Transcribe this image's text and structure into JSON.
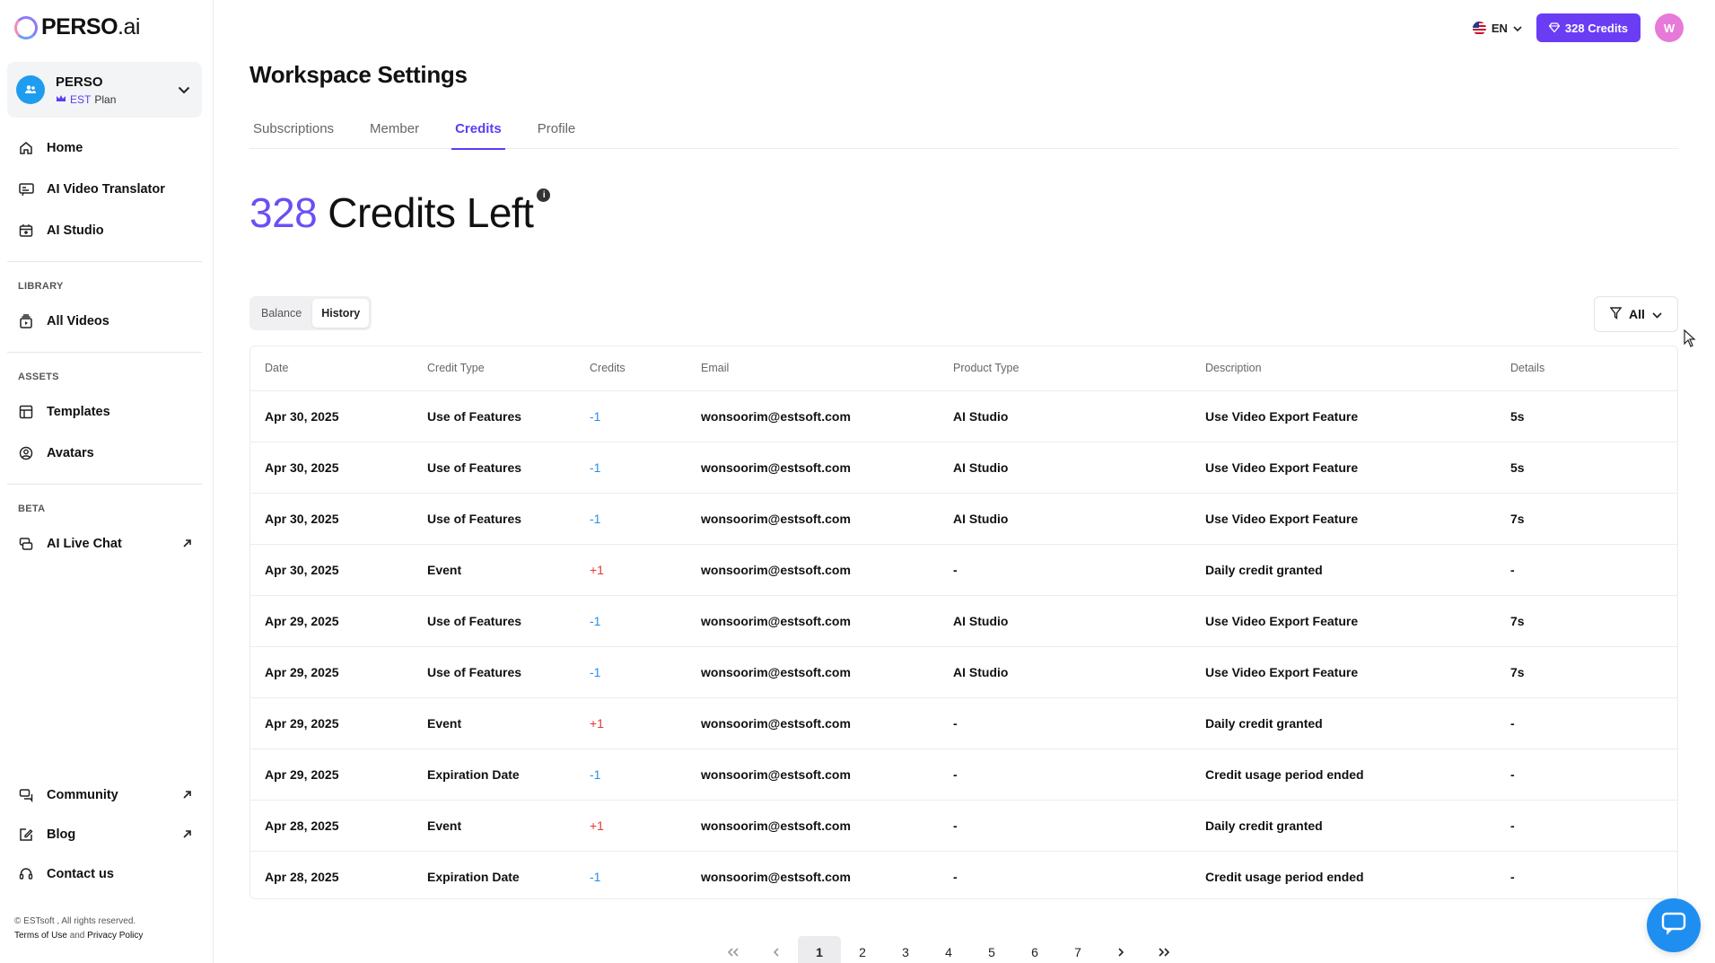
{
  "brand": {
    "logo_main": "PERSO",
    "logo_suffix": ".ai"
  },
  "workspace": {
    "name": "PERSO",
    "plan_badge": "EST",
    "plan_suffix": "Plan"
  },
  "nav": {
    "main": [
      {
        "label": "Home",
        "icon": "home-icon"
      },
      {
        "label": "AI Video Translator",
        "icon": "translate-icon"
      },
      {
        "label": "AI Studio",
        "icon": "studio-icon"
      }
    ],
    "library_label": "LIBRARY",
    "library": [
      {
        "label": "All Videos",
        "icon": "videos-icon"
      }
    ],
    "assets_label": "ASSETS",
    "assets": [
      {
        "label": "Templates",
        "icon": "templates-icon"
      },
      {
        "label": "Avatars",
        "icon": "avatar-icon"
      }
    ],
    "beta_label": "BETA",
    "beta": [
      {
        "label": "AI Live Chat",
        "icon": "live-chat-icon"
      }
    ],
    "bottom": [
      {
        "label": "Community",
        "icon": "community-icon"
      },
      {
        "label": "Blog",
        "icon": "blog-icon"
      },
      {
        "label": "Contact us",
        "icon": "headset-icon"
      }
    ]
  },
  "footer": {
    "copyright": "© ESTsoft , All rights reserved.",
    "terms": "Terms of Use",
    "and": "and",
    "privacy": "Privacy Policy"
  },
  "topbar": {
    "language": "EN",
    "credits_button": "328 Credits",
    "user_initial": "W"
  },
  "page": {
    "title": "Workspace Settings",
    "tabs": [
      "Subscriptions",
      "Member",
      "Credits",
      "Profile"
    ],
    "active_tab": "Credits",
    "credits_number": "328",
    "credits_text": "Credits Left",
    "segments": [
      "Balance",
      "History"
    ],
    "active_segment": "History",
    "filter_label": "All"
  },
  "table": {
    "headers": [
      "Date",
      "Credit Type",
      "Credits",
      "Email",
      "Product Type",
      "Description",
      "Details"
    ],
    "rows": [
      {
        "date": "Apr 30, 2025",
        "type": "Use of Features",
        "credits": "-1",
        "email": "wonsoorim@estsoft.com",
        "product": "AI Studio",
        "description": "Use Video Export Feature",
        "details": "5s"
      },
      {
        "date": "Apr 30, 2025",
        "type": "Use of Features",
        "credits": "-1",
        "email": "wonsoorim@estsoft.com",
        "product": "AI Studio",
        "description": "Use Video Export Feature",
        "details": "5s"
      },
      {
        "date": "Apr 30, 2025",
        "type": "Use of Features",
        "credits": "-1",
        "email": "wonsoorim@estsoft.com",
        "product": "AI Studio",
        "description": "Use Video Export Feature",
        "details": "7s"
      },
      {
        "date": "Apr 30, 2025",
        "type": "Event",
        "credits": "+1",
        "email": "wonsoorim@estsoft.com",
        "product": "-",
        "description": "Daily credit granted",
        "details": "-"
      },
      {
        "date": "Apr 29, 2025",
        "type": "Use of Features",
        "credits": "-1",
        "email": "wonsoorim@estsoft.com",
        "product": "AI Studio",
        "description": "Use Video Export Feature",
        "details": "7s"
      },
      {
        "date": "Apr 29, 2025",
        "type": "Use of Features",
        "credits": "-1",
        "email": "wonsoorim@estsoft.com",
        "product": "AI Studio",
        "description": "Use Video Export Feature",
        "details": "7s"
      },
      {
        "date": "Apr 29, 2025",
        "type": "Event",
        "credits": "+1",
        "email": "wonsoorim@estsoft.com",
        "product": "-",
        "description": "Daily credit granted",
        "details": "-"
      },
      {
        "date": "Apr 29, 2025",
        "type": "Expiration Date",
        "credits": "-1",
        "email": "wonsoorim@estsoft.com",
        "product": "-",
        "description": "Credit usage period ended",
        "details": "-"
      },
      {
        "date": "Apr 28, 2025",
        "type": "Event",
        "credits": "+1",
        "email": "wonsoorim@estsoft.com",
        "product": "-",
        "description": "Daily credit granted",
        "details": "-"
      },
      {
        "date": "Apr 28, 2025",
        "type": "Expiration Date",
        "credits": "-1",
        "email": "wonsoorim@estsoft.com",
        "product": "-",
        "description": "Credit usage period ended",
        "details": "-"
      }
    ]
  },
  "pagination": {
    "pages": [
      "1",
      "2",
      "3",
      "4",
      "5",
      "6",
      "7"
    ],
    "current": "1"
  },
  "colors": {
    "accent": "#6a3df5",
    "negative": "#2d8ce6",
    "positive": "#e53935",
    "chat": "#1f8ef1"
  }
}
